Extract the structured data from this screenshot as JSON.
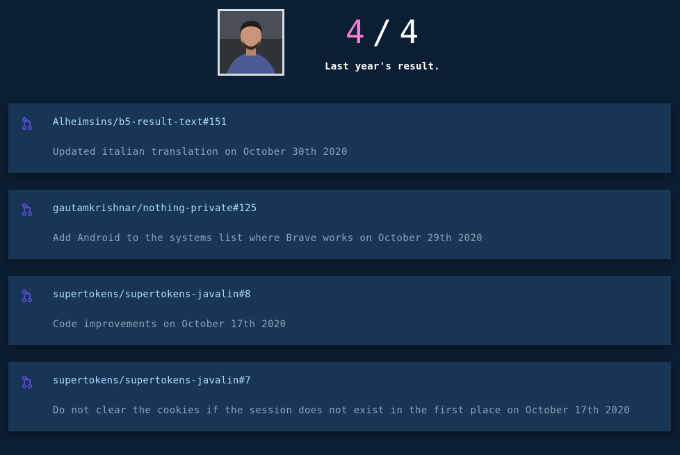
{
  "header": {
    "score_got": "4",
    "score_sep": "/",
    "score_total": "4",
    "caption": "Last year's result."
  },
  "colors": {
    "background": "#0c1e33",
    "card": "#183555",
    "accent_pink": "#f47fd4",
    "link": "#a9d8ff",
    "muted": "#8aa3bd",
    "icon": "#5b4bd6"
  },
  "icons": {
    "pull_request": "git-pull-request-icon"
  },
  "pull_requests": [
    {
      "title": "Alheimsins/b5-result-text#151",
      "description": "Updated italian translation on October 30th 2020"
    },
    {
      "title": "gautamkrishnar/nothing-private#125",
      "description": "Add Android to the systems list where Brave works on October 29th 2020"
    },
    {
      "title": "supertokens/supertokens-javalin#8",
      "description": "Code improvements on October 17th 2020"
    },
    {
      "title": "supertokens/supertokens-javalin#7",
      "description": "Do not clear the cookies if the session does not exist in the first place on October 17th 2020"
    }
  ]
}
